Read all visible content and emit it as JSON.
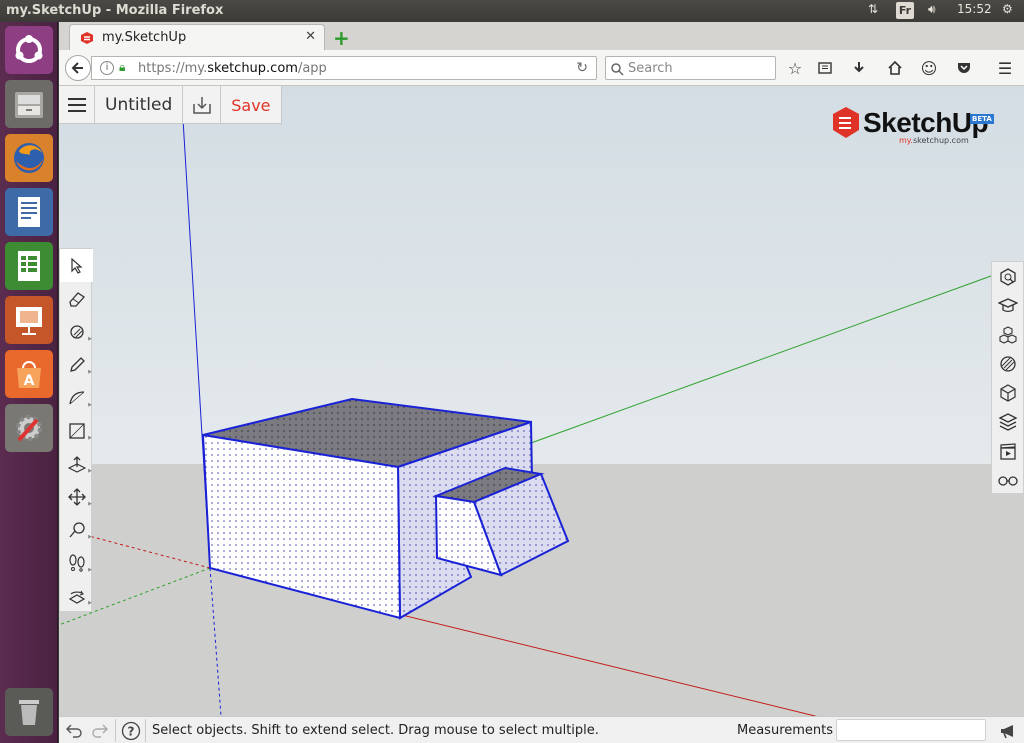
{
  "window": {
    "title": "my.SketchUp - Mozilla Firefox"
  },
  "indicators": {
    "keyboard": "Fr",
    "time": "15:52"
  },
  "launcher": {
    "items": [
      {
        "icon": "ubuntu-dash-icon"
      },
      {
        "icon": "files-icon"
      },
      {
        "icon": "firefox-icon"
      },
      {
        "icon": "writer-icon"
      },
      {
        "icon": "calc-icon"
      },
      {
        "icon": "impress-icon"
      },
      {
        "icon": "software-center-icon"
      },
      {
        "icon": "system-settings-icon"
      },
      {
        "icon": "trash-icon"
      }
    ]
  },
  "browser": {
    "tab_title": "my.SketchUp",
    "url_prefix": "https://my.",
    "url_host": "sketchup.com",
    "url_path": "/app",
    "search_placeholder": "Search"
  },
  "app": {
    "doc_title": "Untitled",
    "save_label": "Save",
    "logo_text": "SketchUp",
    "logo_badge": "BETA",
    "logo_sub_prefix": "my.",
    "logo_sub_suffix": "sketchup.com",
    "left_tools": [
      "select-tool",
      "eraser-tool",
      "paint-bucket-tool",
      "pencil-tool",
      "arc-tool",
      "rectangle-tool",
      "push-pull-tool",
      "move-tool",
      "tape-measure-tool",
      "walk-tool",
      "orbit-tool"
    ],
    "right_tools": [
      "3d-warehouse-panel",
      "instructor-panel",
      "components-panel",
      "materials-panel",
      "entity-info-panel",
      "layers-panel",
      "scenes-panel",
      "styles-panel"
    ]
  },
  "status": {
    "hint": "Select objects. Shift to extend select. Drag mouse to select multiple.",
    "measurements_label": "Measurements",
    "measurements_value": ""
  },
  "colors": {
    "accent_red": "#e03327",
    "axis_red": "#c21b1b",
    "axis_green": "#2aa02a",
    "axis_blue": "#1a22d6",
    "launcher_bg": "#5b2c4f"
  }
}
